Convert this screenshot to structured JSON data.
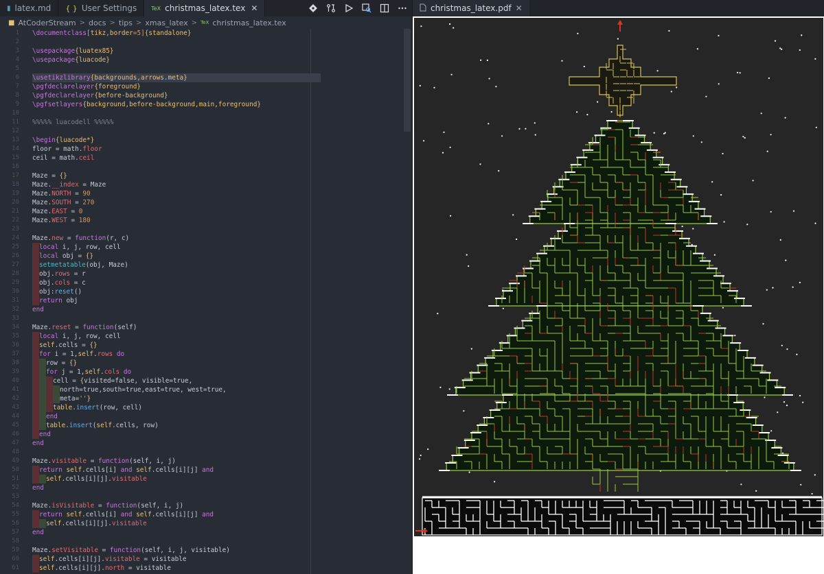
{
  "editor": {
    "tabs": [
      {
        "label": "latex.md",
        "icon": "markdown-icon",
        "active": false
      },
      {
        "label": "User Settings",
        "icon": "json-icon",
        "active": false
      },
      {
        "label": "christmas_latex.tex",
        "icon": "tex-icon",
        "active": true
      }
    ],
    "breadcrumb": [
      "AtCoderStream",
      "docs",
      "tips",
      "xmas_latex",
      "christmas_latex.tex"
    ],
    "line_numbers": [
      "1",
      "2",
      "3",
      "4",
      "5",
      "6",
      "7",
      "8",
      "9",
      "10",
      "11",
      "12",
      "13",
      "14",
      "15",
      "16",
      "17",
      "18",
      "19",
      "20",
      "21",
      "22",
      "23",
      "24",
      "25",
      "26",
      "27",
      "28",
      "29",
      "30",
      "31",
      "32",
      "33",
      "34",
      "35",
      "36",
      "37",
      "38",
      "39",
      "40",
      "41",
      "42",
      "43",
      "44",
      "45",
      "46",
      "47",
      "48",
      "49",
      "50",
      "51",
      "52",
      "53",
      "54",
      "55",
      "56",
      "57",
      "58",
      "59",
      "60",
      "61"
    ],
    "code_lines": [
      [
        [
          "\\documentclass",
          "#c678dd"
        ],
        [
          "[",
          "#abb2bf"
        ],
        [
          "tikz",
          "#e5c07b"
        ],
        [
          ",",
          "#abb2bf"
        ],
        [
          "border",
          "#e5c07b"
        ],
        [
          "=5]",
          "#d19a66"
        ],
        [
          "{standalone}",
          "#e5c07b"
        ]
      ],
      [],
      [
        [
          "\\usepackage",
          "#c678dd"
        ],
        [
          "{luatex85}",
          "#e5c07b"
        ]
      ],
      [
        [
          "\\usepackage",
          "#c678dd"
        ],
        [
          "{luacode}",
          "#e5c07b"
        ]
      ],
      [],
      [
        [
          "\\usetikzlibrary",
          "#c678dd"
        ],
        [
          "{backgrounds,arrows.meta}",
          "#e5c07b"
        ]
      ],
      [
        [
          "\\pgfdeclarelayer",
          "#c678dd"
        ],
        [
          "{foreground}",
          "#e5c07b"
        ]
      ],
      [
        [
          "\\pgfdeclarelayer",
          "#c678dd"
        ],
        [
          "{before-background}",
          "#e5c07b"
        ]
      ],
      [
        [
          "\\pgfsetlayers",
          "#c678dd"
        ],
        [
          "{background,before-background,main,foreground}",
          "#e5c07b"
        ]
      ],
      [],
      [
        [
          "%%%%% luacodell %%%%%",
          "#7f848e"
        ]
      ],
      [],
      [
        [
          "\\begin",
          "#c678dd"
        ],
        [
          "{luacode*}",
          "#e5c07b"
        ]
      ],
      [
        [
          "floor = math.",
          "#c8ccd4"
        ],
        [
          "floor",
          "#e06c75"
        ]
      ],
      [
        [
          "ceil = math.",
          "#c8ccd4"
        ],
        [
          "ceil",
          "#e06c75"
        ]
      ],
      [],
      [
        [
          "Maze = ",
          "#c8ccd4"
        ],
        [
          "{}",
          "#e5c07b"
        ]
      ],
      [
        [
          "Maze.",
          "#c8ccd4"
        ],
        [
          "__index",
          "#e06c75"
        ],
        [
          " = Maze",
          "#c8ccd4"
        ]
      ],
      [
        [
          "Maze.",
          "#c8ccd4"
        ],
        [
          "NORTH",
          "#e06c75"
        ],
        [
          " = ",
          "#c8ccd4"
        ],
        [
          "90",
          "#d19a66"
        ]
      ],
      [
        [
          "Maze.",
          "#c8ccd4"
        ],
        [
          "SOUTH",
          "#e06c75"
        ],
        [
          " = ",
          "#c8ccd4"
        ],
        [
          "270",
          "#d19a66"
        ]
      ],
      [
        [
          "Maze.",
          "#c8ccd4"
        ],
        [
          "EAST",
          "#e06c75"
        ],
        [
          " = ",
          "#c8ccd4"
        ],
        [
          "0",
          "#d19a66"
        ]
      ],
      [
        [
          "Maze.",
          "#c8ccd4"
        ],
        [
          "WEST",
          "#e06c75"
        ],
        [
          " = ",
          "#c8ccd4"
        ],
        [
          "180",
          "#d19a66"
        ]
      ],
      [],
      [
        [
          "Maze.",
          "#c8ccd4"
        ],
        [
          "new",
          "#e06c75"
        ],
        [
          " = ",
          "#c8ccd4"
        ],
        [
          "function",
          "#c678dd"
        ],
        [
          "(r, c)",
          "#c8ccd4"
        ]
      ],
      [
        [
          "~1",
          ""
        ],
        [
          "local",
          "#c678dd"
        ],
        [
          " i, j, row, cell",
          "#c8ccd4"
        ]
      ],
      [
        [
          "~1",
          ""
        ],
        [
          "local",
          "#c678dd"
        ],
        [
          " obj = ",
          "#c8ccd4"
        ],
        [
          "{}",
          "#e5c07b"
        ]
      ],
      [
        [
          "~1",
          ""
        ],
        [
          "setmetatable",
          "#56b6c2"
        ],
        [
          "(obj, Maze)",
          "#c8ccd4"
        ]
      ],
      [
        [
          "~1",
          ""
        ],
        [
          "obj.",
          "#c8ccd4"
        ],
        [
          "rows",
          "#e06c75"
        ],
        [
          " = r",
          "#c8ccd4"
        ]
      ],
      [
        [
          "~1",
          ""
        ],
        [
          "obj.",
          "#c8ccd4"
        ],
        [
          "cols",
          "#e06c75"
        ],
        [
          " = c",
          "#c8ccd4"
        ]
      ],
      [
        [
          "~1",
          ""
        ],
        [
          "obj:",
          "#c8ccd4"
        ],
        [
          "reset",
          "#61afef"
        ],
        [
          "()",
          "#c8ccd4"
        ]
      ],
      [
        [
          "~1",
          ""
        ],
        [
          "return",
          "#c678dd"
        ],
        [
          " obj",
          "#c8ccd4"
        ]
      ],
      [
        [
          "end",
          "#c678dd"
        ]
      ],
      [],
      [
        [
          "Maze.",
          "#c8ccd4"
        ],
        [
          "reset",
          "#e06c75"
        ],
        [
          " = ",
          "#c8ccd4"
        ],
        [
          "function",
          "#c678dd"
        ],
        [
          "(self)",
          "#c8ccd4"
        ]
      ],
      [
        [
          "~1",
          ""
        ],
        [
          "local",
          "#c678dd"
        ],
        [
          " i, j, row, cell",
          "#c8ccd4"
        ]
      ],
      [
        [
          "~1",
          ""
        ],
        [
          "self",
          "#e5c07b"
        ],
        [
          ".cells = ",
          "#c8ccd4"
        ],
        [
          "{}",
          "#e5c07b"
        ]
      ],
      [
        [
          "~1",
          ""
        ],
        [
          "for",
          "#c678dd"
        ],
        [
          " i = 1,",
          "#c8ccd4"
        ],
        [
          "self",
          "#e5c07b"
        ],
        [
          ".",
          "#c8ccd4"
        ],
        [
          "rows",
          "#e06c75"
        ],
        [
          " do",
          "#c678dd"
        ]
      ],
      [
        [
          "~2",
          ""
        ],
        [
          "row = ",
          "#c8ccd4"
        ],
        [
          "{}",
          "#e5c07b"
        ]
      ],
      [
        [
          "~2",
          ""
        ],
        [
          "for",
          "#c678dd"
        ],
        [
          " j = 1,",
          "#c8ccd4"
        ],
        [
          "self",
          "#e5c07b"
        ],
        [
          ".",
          "#c8ccd4"
        ],
        [
          "cols",
          "#e06c75"
        ],
        [
          " do",
          "#c678dd"
        ]
      ],
      [
        [
          "~3",
          ""
        ],
        [
          "cell = ",
          "#c8ccd4"
        ],
        [
          "{",
          "#e5c07b"
        ],
        [
          "visited=false, visible=true,",
          "#c8ccd4"
        ]
      ],
      [
        [
          "~4",
          ""
        ],
        [
          "north=true,south=true,east=true, west=true,",
          "#c8ccd4"
        ]
      ],
      [
        [
          "~4",
          ""
        ],
        [
          "meta=",
          "#c8ccd4"
        ],
        [
          "''",
          "#98c379"
        ],
        [
          "}",
          "#e5c07b"
        ]
      ],
      [
        [
          "~3",
          ""
        ],
        [
          "table",
          "#e5c07b"
        ],
        [
          ".",
          "#c8ccd4"
        ],
        [
          "insert",
          "#61afef"
        ],
        [
          "(row, cell)",
          "#c8ccd4"
        ]
      ],
      [
        [
          "~2",
          ""
        ],
        [
          "end",
          "#c678dd"
        ]
      ],
      [
        [
          "~2",
          ""
        ],
        [
          "table",
          "#e5c07b"
        ],
        [
          ".",
          "#c8ccd4"
        ],
        [
          "insert",
          "#61afef"
        ],
        [
          "(",
          "#c8ccd4"
        ],
        [
          "self",
          "#e5c07b"
        ],
        [
          ".cells, row)",
          "#c8ccd4"
        ]
      ],
      [
        [
          "~1",
          ""
        ],
        [
          "end",
          "#c678dd"
        ]
      ],
      [
        [
          "end",
          "#c678dd"
        ]
      ],
      [],
      [
        [
          "Maze.",
          "#c8ccd4"
        ],
        [
          "visitable",
          "#e06c75"
        ],
        [
          " = ",
          "#c8ccd4"
        ],
        [
          "function",
          "#c678dd"
        ],
        [
          "(self, i, j)",
          "#c8ccd4"
        ]
      ],
      [
        [
          "~1",
          ""
        ],
        [
          "return",
          "#c678dd"
        ],
        [
          " self",
          "#e5c07b"
        ],
        [
          ".cells[i] ",
          "#c8ccd4"
        ],
        [
          "and",
          "#c678dd"
        ],
        [
          " self",
          "#e5c07b"
        ],
        [
          ".cells[i][j] ",
          "#c8ccd4"
        ],
        [
          "and",
          "#c678dd"
        ]
      ],
      [
        [
          "~2",
          ""
        ],
        [
          "self",
          "#e5c07b"
        ],
        [
          ".cells[i][j].",
          "#c8ccd4"
        ],
        [
          "visitable",
          "#e06c75"
        ]
      ],
      [
        [
          "end",
          "#c678dd"
        ]
      ],
      [],
      [
        [
          "Maze.",
          "#c8ccd4"
        ],
        [
          "isVisitable",
          "#e06c75"
        ],
        [
          " = ",
          "#c8ccd4"
        ],
        [
          "function",
          "#c678dd"
        ],
        [
          "(self, i, j)",
          "#c8ccd4"
        ]
      ],
      [
        [
          "~1",
          ""
        ],
        [
          "return",
          "#c678dd"
        ],
        [
          " self",
          "#e5c07b"
        ],
        [
          ".cells[i] ",
          "#c8ccd4"
        ],
        [
          "and",
          "#c678dd"
        ],
        [
          " self",
          "#e5c07b"
        ],
        [
          ".cells[i][j] ",
          "#c8ccd4"
        ],
        [
          "and",
          "#c678dd"
        ]
      ],
      [
        [
          "~2",
          ""
        ],
        [
          "self",
          "#e5c07b"
        ],
        [
          ".cells[i][j].",
          "#c8ccd4"
        ],
        [
          "visitable",
          "#e06c75"
        ]
      ],
      [
        [
          "end",
          "#c678dd"
        ]
      ],
      [],
      [
        [
          "Maze.",
          "#c8ccd4"
        ],
        [
          "setVisitable",
          "#e06c75"
        ],
        [
          " = ",
          "#c8ccd4"
        ],
        [
          "function",
          "#c678dd"
        ],
        [
          "(self, i, j, visitable)",
          "#c8ccd4"
        ]
      ],
      [
        [
          "~1",
          ""
        ],
        [
          "self",
          "#e5c07b"
        ],
        [
          ".cells[i][j].",
          "#c8ccd4"
        ],
        [
          "visitable",
          "#e06c75"
        ],
        [
          " = visitable",
          "#c8ccd4"
        ]
      ],
      [
        [
          "~1",
          ""
        ],
        [
          "self",
          "#e5c07b"
        ],
        [
          ".cells[i][j].",
          "#c8ccd4"
        ],
        [
          "north",
          "#e06c75"
        ],
        [
          " = visitable",
          "#c8ccd4"
        ]
      ]
    ]
  },
  "pdf": {
    "tab_label": "christmas_latex.pdf",
    "tab_icon": "file-icon",
    "colors": {
      "background": "#262626",
      "snow": "#ffffff",
      "tree_line": "#9ccc3c",
      "tree_fill": "#0c1a0c",
      "star_line": "#d8c254",
      "path_red": "#c0392b",
      "path_orange": "#d9782a",
      "ground_fill": "#0a0a0a",
      "arrow": "#e03020"
    }
  }
}
